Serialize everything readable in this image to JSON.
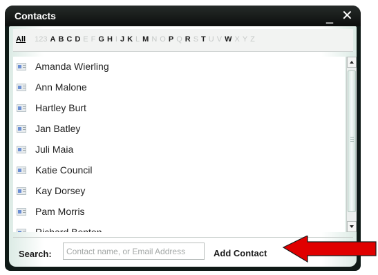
{
  "window": {
    "title": "Contacts",
    "minimize_label": "_",
    "close_label": "✕"
  },
  "alphabet": {
    "all_label": "All",
    "items": [
      {
        "label": "123",
        "enabled": false
      },
      {
        "label": "A",
        "enabled": true
      },
      {
        "label": "B",
        "enabled": true
      },
      {
        "label": "C",
        "enabled": true
      },
      {
        "label": "D",
        "enabled": true
      },
      {
        "label": "E",
        "enabled": false
      },
      {
        "label": "F",
        "enabled": false
      },
      {
        "label": "G",
        "enabled": true
      },
      {
        "label": "H",
        "enabled": true
      },
      {
        "label": "I",
        "enabled": false
      },
      {
        "label": "J",
        "enabled": true
      },
      {
        "label": "K",
        "enabled": true
      },
      {
        "label": "L",
        "enabled": false
      },
      {
        "label": "M",
        "enabled": true
      },
      {
        "label": "N",
        "enabled": false
      },
      {
        "label": "O",
        "enabled": false
      },
      {
        "label": "P",
        "enabled": true
      },
      {
        "label": "Q",
        "enabled": false
      },
      {
        "label": "R",
        "enabled": true
      },
      {
        "label": "S",
        "enabled": false
      },
      {
        "label": "T",
        "enabled": true
      },
      {
        "label": "U",
        "enabled": false
      },
      {
        "label": "V",
        "enabled": false
      },
      {
        "label": "W",
        "enabled": true
      },
      {
        "label": "X",
        "enabled": false
      },
      {
        "label": "Y",
        "enabled": false
      },
      {
        "label": "Z",
        "enabled": false
      }
    ]
  },
  "contacts": [
    {
      "name": "Amanda Wierling",
      "icon": "contact-card-icon"
    },
    {
      "name": "Ann Malone",
      "icon": "contact-card-icon"
    },
    {
      "name": "Hartley Burt",
      "icon": "contact-card-icon"
    },
    {
      "name": "Jan Batley",
      "icon": "contact-card-icon"
    },
    {
      "name": "Juli Maia",
      "icon": "contact-card-icon"
    },
    {
      "name": "Katie Council",
      "icon": "contact-card-icon"
    },
    {
      "name": "Kay Dorsey",
      "icon": "contact-card-icon"
    },
    {
      "name": "Pam Morris",
      "icon": "contact-card-icon"
    },
    {
      "name": "Richard Benton",
      "icon": "contact-card-icon"
    }
  ],
  "search": {
    "label": "Search:",
    "placeholder": "Contact name, or Email Address",
    "value": ""
  },
  "actions": {
    "add_contact_label": "Add Contact"
  },
  "annotation": {
    "color": "#e00000",
    "icon": "red-arrow-icon"
  }
}
